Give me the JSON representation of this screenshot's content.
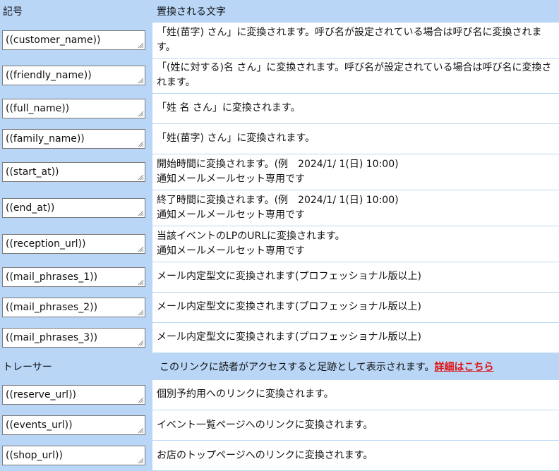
{
  "header": {
    "col1": "記号",
    "col2": "置換される文字"
  },
  "rows1": [
    {
      "code": "((customer_name))",
      "desc": [
        "「姓(苗字) さん」に変換されます。呼び名が設定されている場合は呼び名に変換されます。"
      ],
      "h": 50
    },
    {
      "code": "((friendly_name))",
      "desc": [
        "「(姓に対する)名 さん」に変換されます。呼び名が設定されている場合は呼び名に変換されます。"
      ],
      "h": 50
    },
    {
      "code": "((full_name))",
      "desc": [
        "「姓 名 さん」に変換されます。"
      ],
      "h": 43
    },
    {
      "code": "((family_name))",
      "desc": [
        "「姓(苗字) さん」に変換されます。"
      ],
      "h": 43
    },
    {
      "code": "((start_at))",
      "desc": [
        "開始時間に変換されます。(例　2024/1/ 1(日) 10:00)",
        "通知メールメールセット専用です"
      ],
      "h": 51
    },
    {
      "code": "((end_at))",
      "desc": [
        "終了時間に変換されます。(例　2024/1/ 1(日) 10:00)",
        "通知メールメールセット専用です"
      ],
      "h": 51
    },
    {
      "code": "((reception_url))",
      "desc": [
        "当該イベントのLPのURLに変換されます。",
        "通知メールメールセット専用です"
      ],
      "h": 51
    },
    {
      "code": "((mail_phrases_1))",
      "desc": [
        "メール内定型文に変換されます(プロフェッショナル版以上)"
      ],
      "h": 43
    },
    {
      "code": "((mail_phrases_2))",
      "desc": [
        "メール内定型文に変換されます(プロフェッショナル版以上)"
      ],
      "h": 43
    },
    {
      "code": "((mail_phrases_3))",
      "desc": [
        "メール内定型文に変換されます(プロフェッショナル版以上)"
      ],
      "h": 43
    }
  ],
  "tracer": {
    "label": "トレーサー",
    "desc": "このリンクに読者がアクセスすると足跡として表示されます。",
    "link": "詳細はこちら"
  },
  "rows2": [
    {
      "code": "((reserve_url))",
      "desc": [
        "個別予約用へのリンクに変換されます。"
      ],
      "h": 43
    },
    {
      "code": "((events_url))",
      "desc": [
        "イベント一覧ページへのリンクに変換されます。"
      ],
      "h": 43
    },
    {
      "code": "((shop_url))",
      "desc": [
        "お店のトップページへのリンクに変換されます。"
      ],
      "h": 43
    }
  ]
}
